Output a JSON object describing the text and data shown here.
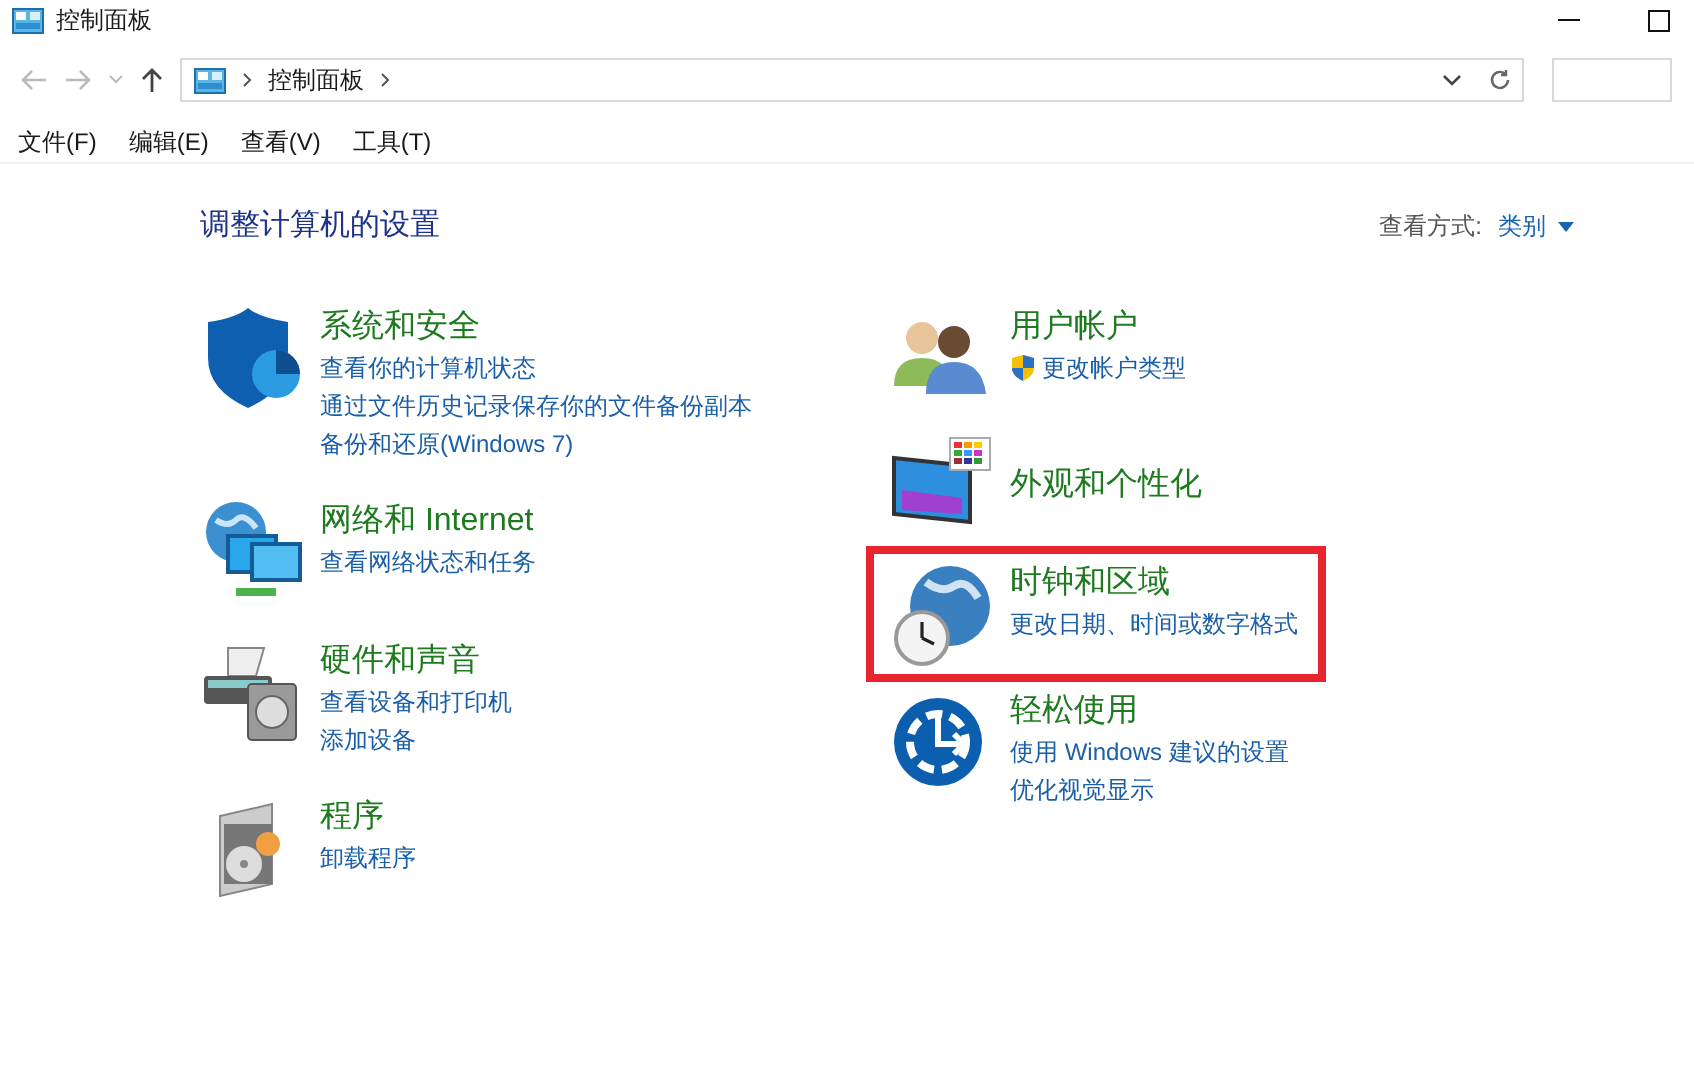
{
  "window": {
    "title": "控制面板"
  },
  "address_bar": {
    "crumbs": [
      "控制面板"
    ]
  },
  "menu": [
    "文件(F)",
    "编辑(E)",
    "查看(V)",
    "工具(T)"
  ],
  "heading": "调整计算机的设置",
  "view_by": {
    "label": "查看方式:",
    "value": "类别"
  },
  "columns": [
    [
      {
        "kind": "security",
        "title": "系统和安全",
        "highlighted": false,
        "links": [
          {
            "text": "查看你的计算机状态",
            "shield": false
          },
          {
            "text": "通过文件历史记录保存你的文件备份副本",
            "shield": false
          },
          {
            "text": "备份和还原(Windows 7)",
            "shield": false
          }
        ]
      },
      {
        "kind": "network",
        "title": "网络和 Internet",
        "highlighted": false,
        "links": [
          {
            "text": "查看网络状态和任务",
            "shield": false
          }
        ]
      },
      {
        "kind": "hardware",
        "title": "硬件和声音",
        "highlighted": false,
        "links": [
          {
            "text": "查看设备和打印机",
            "shield": false
          },
          {
            "text": "添加设备",
            "shield": false
          }
        ]
      },
      {
        "kind": "programs",
        "title": "程序",
        "highlighted": false,
        "links": [
          {
            "text": "卸载程序",
            "shield": false
          }
        ]
      }
    ],
    [
      {
        "kind": "users",
        "title": "用户帐户",
        "highlighted": false,
        "links": [
          {
            "text": "更改帐户类型",
            "shield": true
          }
        ]
      },
      {
        "kind": "appearance",
        "title": "外观和个性化",
        "highlighted": false
      },
      {
        "kind": "clock",
        "title": "时钟和区域",
        "highlighted": true,
        "links": [
          {
            "text": "更改日期、时间或数字格式",
            "shield": false
          }
        ]
      },
      {
        "kind": "access",
        "title": "轻松使用",
        "highlighted": false,
        "links": [
          {
            "text": "使用 Windows 建议的设置",
            "shield": false
          },
          {
            "text": "优化视觉显示",
            "shield": false
          }
        ]
      }
    ]
  ]
}
